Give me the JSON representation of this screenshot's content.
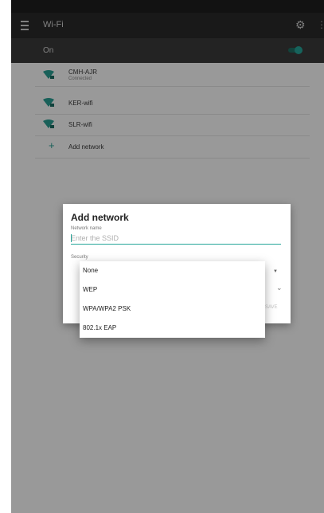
{
  "toolbar": {
    "title": "Wi-Fi",
    "settings_icon": "gear-icon",
    "more_icon": "more-vert-icon",
    "menu_icon": "menu-icon"
  },
  "onbar": {
    "label": "On",
    "toggle_state": "on"
  },
  "networks": [
    {
      "name": "CMH-AJR",
      "status": "Connected",
      "icon": "wifi-lock-icon"
    },
    {
      "name": "KER-wifi",
      "icon": "wifi-lock-icon"
    },
    {
      "name": "SLR-wifi",
      "icon": "wifi-lock-icon"
    }
  ],
  "add_network_label": "Add network",
  "dialog": {
    "title": "Add network",
    "network_name_label": "Network name",
    "ssid_placeholder": "Enter the SSID",
    "security_label": "Security",
    "save_label": "SAVE"
  },
  "security_options": [
    "None",
    "WEP",
    "WPA/WPA2 PSK",
    "802.1x EAP"
  ],
  "colors": {
    "accent": "#26a69a",
    "toolbar": "#2a2a2a",
    "status_bar": "#1e1e1e"
  }
}
